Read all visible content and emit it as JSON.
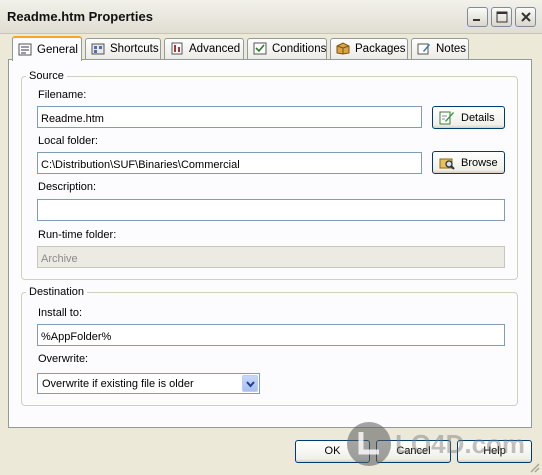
{
  "window": {
    "title": "Readme.htm Properties"
  },
  "tabs": [
    {
      "label": "General",
      "icon": "general-tab-icon"
    },
    {
      "label": "Shortcuts",
      "icon": "shortcuts-tab-icon"
    },
    {
      "label": "Advanced",
      "icon": "advanced-tab-icon"
    },
    {
      "label": "Conditions",
      "icon": "conditions-tab-icon"
    },
    {
      "label": "Packages",
      "icon": "packages-tab-icon"
    },
    {
      "label": "Notes",
      "icon": "notes-tab-icon"
    }
  ],
  "source": {
    "legend": "Source",
    "filename": {
      "label": "Filename:",
      "value": "Readme.htm"
    },
    "details_button": "Details",
    "local_folder": {
      "label": "Local folder:",
      "value": "C:\\Distribution\\SUF\\Binaries\\Commercial"
    },
    "browse_button": "Browse",
    "description": {
      "label": "Description:",
      "value": ""
    },
    "runtime_folder": {
      "label": "Run-time folder:",
      "value": "Archive"
    }
  },
  "destination": {
    "legend": "Destination",
    "install_to": {
      "label": "Install to:",
      "value": "%AppFolder%"
    },
    "overwrite": {
      "label": "Overwrite:",
      "value": "Overwrite if existing file is older"
    }
  },
  "buttons": {
    "ok": "OK",
    "cancel": "Cancel",
    "help": "Help"
  },
  "watermark": {
    "text": "LO4D.com"
  },
  "colors": {
    "window_bg": "#ece9d8",
    "active_tab_accent": "#f5a623",
    "input_border": "#7f9db9"
  }
}
